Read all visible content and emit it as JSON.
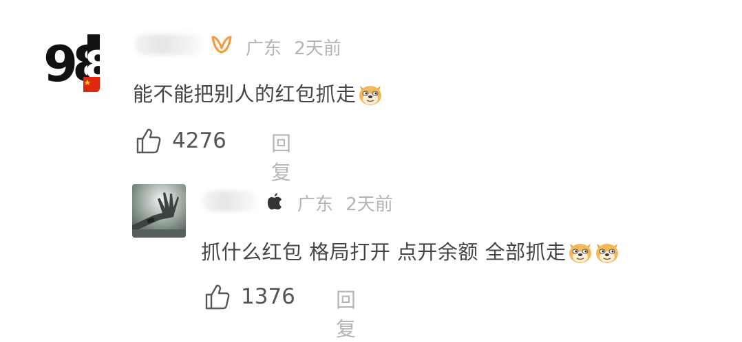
{
  "colors": {
    "accent_orange": "#f59b3f",
    "meta_gray": "#b4b4b4"
  },
  "comments": [
    {
      "badge_icon": "weibo-vip-icon",
      "location": "广东",
      "time": "2天前",
      "text": "能不能把别人的红包抓走",
      "emoji": "doge-emoji",
      "likes": "4276",
      "reply_label": "回复"
    },
    {
      "badge_icon": "apple-icon",
      "location": "广东",
      "time": "2天前",
      "text": "抓什么红包 格局打开 点开余额 全部抓走",
      "emoji": "doge-emoji",
      "likes": "1376",
      "reply_label": "回复"
    }
  ]
}
